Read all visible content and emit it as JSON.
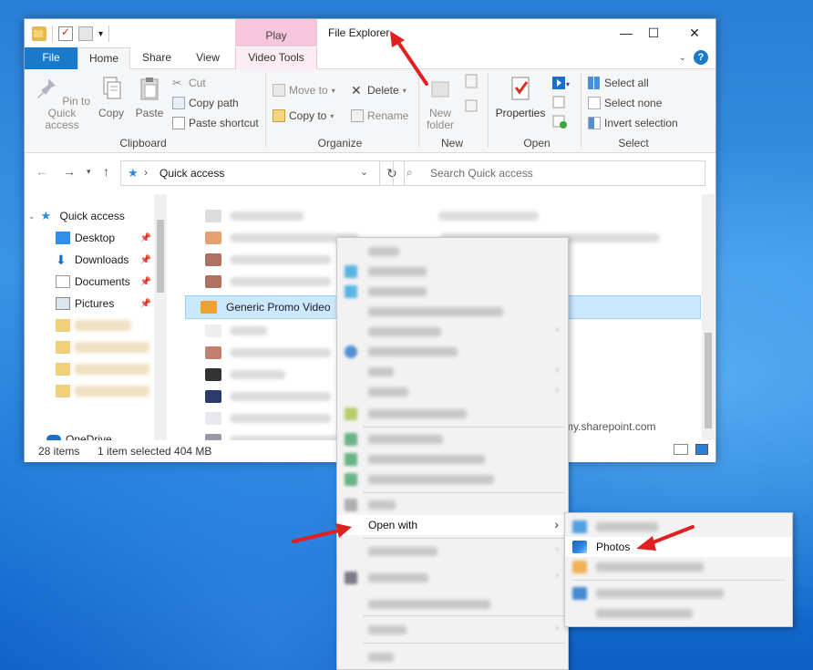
{
  "window": {
    "title": "File Explorer",
    "contextual_tab": "Play",
    "minimize": "—",
    "maximize": "☐",
    "close": "✕"
  },
  "ribbon_tabs": [
    "File",
    "Home",
    "Share",
    "View",
    "Video Tools"
  ],
  "ribbon": {
    "clipboard": {
      "pin": "Pin to Quick access",
      "copy": "Copy",
      "paste": "Paste",
      "cut": "Cut",
      "copy_path": "Copy path",
      "paste_shortcut": "Paste shortcut",
      "label": "Clipboard"
    },
    "organize": {
      "move_to": "Move to",
      "copy_to": "Copy to",
      "delete": "Delete",
      "rename": "Rename",
      "label": "Organize"
    },
    "new": {
      "new_folder": "New folder",
      "label": "New"
    },
    "open": {
      "properties": "Properties",
      "label": "Open"
    },
    "select": {
      "select_all": "Select all",
      "select_none": "Select none",
      "invert": "Invert selection",
      "label": "Select"
    }
  },
  "address": {
    "path": "Quick access",
    "search_placeholder": "Search Quick access"
  },
  "nav": {
    "quick_access": "Quick access",
    "desktop": "Desktop",
    "downloads": "Downloads",
    "documents": "Documents",
    "pictures": "Pictures",
    "onedrive": "OneDrive"
  },
  "files": {
    "selected_name": "Generic Promo Video",
    "location_fragment": "my.sharepoint.com"
  },
  "status": {
    "items": "28 items",
    "selection": "1 item selected  404 MB"
  },
  "context_menu": {
    "open_with": "Open with"
  },
  "submenu": {
    "photos": "Photos"
  },
  "colors": {
    "accent": "#1979ca",
    "selected_row": "#cce8ff",
    "arrow": "#e02020",
    "play_tab": "#f6c6dd"
  }
}
